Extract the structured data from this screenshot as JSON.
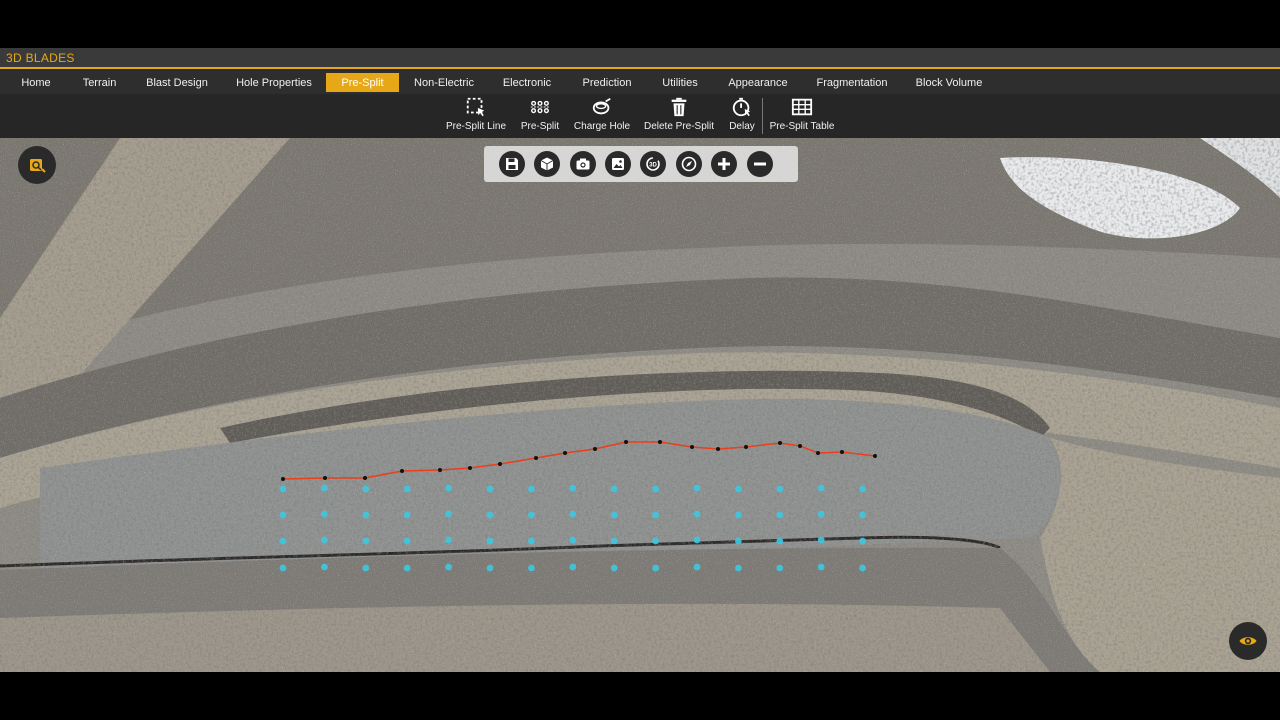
{
  "app": {
    "title": "3D BLADES"
  },
  "menu": {
    "items": [
      {
        "label": "Home"
      },
      {
        "label": "Terrain"
      },
      {
        "label": "Blast Design"
      },
      {
        "label": "Hole Properties"
      },
      {
        "label": "Pre-Split",
        "active": true
      },
      {
        "label": "Non-Electric"
      },
      {
        "label": "Electronic"
      },
      {
        "label": "Prediction"
      },
      {
        "label": "Utilities"
      },
      {
        "label": "Appearance"
      },
      {
        "label": "Fragmentation"
      },
      {
        "label": "Block Volume"
      }
    ]
  },
  "toolbar": {
    "items": [
      {
        "label": "Pre-Split Line",
        "icon": "select-area-icon"
      },
      {
        "label": "Pre-Split",
        "icon": "hole-grid-icon"
      },
      {
        "label": "Charge Hole",
        "icon": "charge-icon"
      },
      {
        "label": "Delete Pre-Split",
        "icon": "trash-icon"
      },
      {
        "label": "Delay",
        "icon": "timer-icon"
      },
      {
        "label": "Pre-Split Table",
        "icon": "table-icon"
      }
    ]
  },
  "view_toolbar": {
    "buttons": [
      "save-icon",
      "cube-icon",
      "camera-icon",
      "image-icon",
      "3d-rotate-icon",
      "compass-icon",
      "zoom-in-icon",
      "zoom-out-icon"
    ]
  },
  "colors": {
    "accent": "#e6a817",
    "presplit_line": "#e8401c",
    "hole_marker": "#3ec8e0"
  }
}
